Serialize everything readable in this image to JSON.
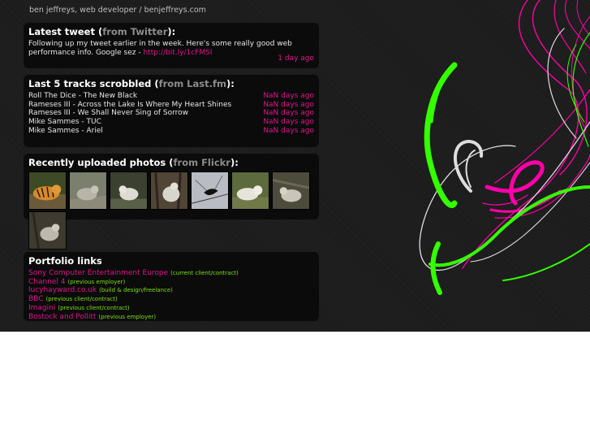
{
  "site": {
    "title": "ben jeffreys, web developer / benjeffreys.com"
  },
  "colors": {
    "accent_pink": "#e0148c",
    "accent_green": "#7fe019",
    "swirl_green": "#33ff00",
    "swirl_pink": "#ff00a8"
  },
  "tweet": {
    "heading": "Latest tweet (",
    "source": "from Twitter",
    "heading_end": "):",
    "text": "Following up my tweet earlier in the week. Here's some really good web performance info. Google sez - ",
    "link": "http://bit.ly/1cFMSl",
    "time": "1 day ago"
  },
  "tracks": {
    "heading": "Last 5 tracks scrobbled (",
    "source": "from Last.fm",
    "heading_end": "):",
    "items": [
      {
        "title": "Roll The Dice - The New Black",
        "when": "NaN days ago"
      },
      {
        "title": "Rameses III - Across the Lake Is Where My Heart Shines",
        "when": "NaN days ago"
      },
      {
        "title": "Rameses III - We Shall Never Sing of Sorrow",
        "when": "NaN days ago"
      },
      {
        "title": "Mike Sammes - TUC",
        "when": "NaN days ago"
      },
      {
        "title": "Mike Sammes - Ariel",
        "when": "NaN days ago"
      }
    ]
  },
  "photos": {
    "heading": "Recently uploaded photos (",
    "source": "from Flickr",
    "heading_end": "):",
    "items": [
      {
        "icon": "tiger-photo"
      },
      {
        "icon": "wolf-photo"
      },
      {
        "icon": "wolf-photo"
      },
      {
        "icon": "wolf-photo"
      },
      {
        "icon": "bird-photo"
      },
      {
        "icon": "wolf-photo"
      },
      {
        "icon": "wolf-photo"
      },
      {
        "icon": "wolf-photo"
      }
    ]
  },
  "portfolio": {
    "heading": "Portfolio links",
    "items": [
      {
        "name": "Sony Computer Entertainment Europe",
        "note": "(current client/contract)"
      },
      {
        "name": "Channel 4",
        "note": "(previous employer)"
      },
      {
        "name": "lucyhayward.co.uk",
        "note": "(build & design/freelance)"
      },
      {
        "name": "BBC",
        "note": "(previous client/contract)"
      },
      {
        "name": "Imagini",
        "note": "(previous client/contract)"
      },
      {
        "name": "Bostock and Pollitt",
        "note": "(previous employer)"
      }
    ]
  }
}
